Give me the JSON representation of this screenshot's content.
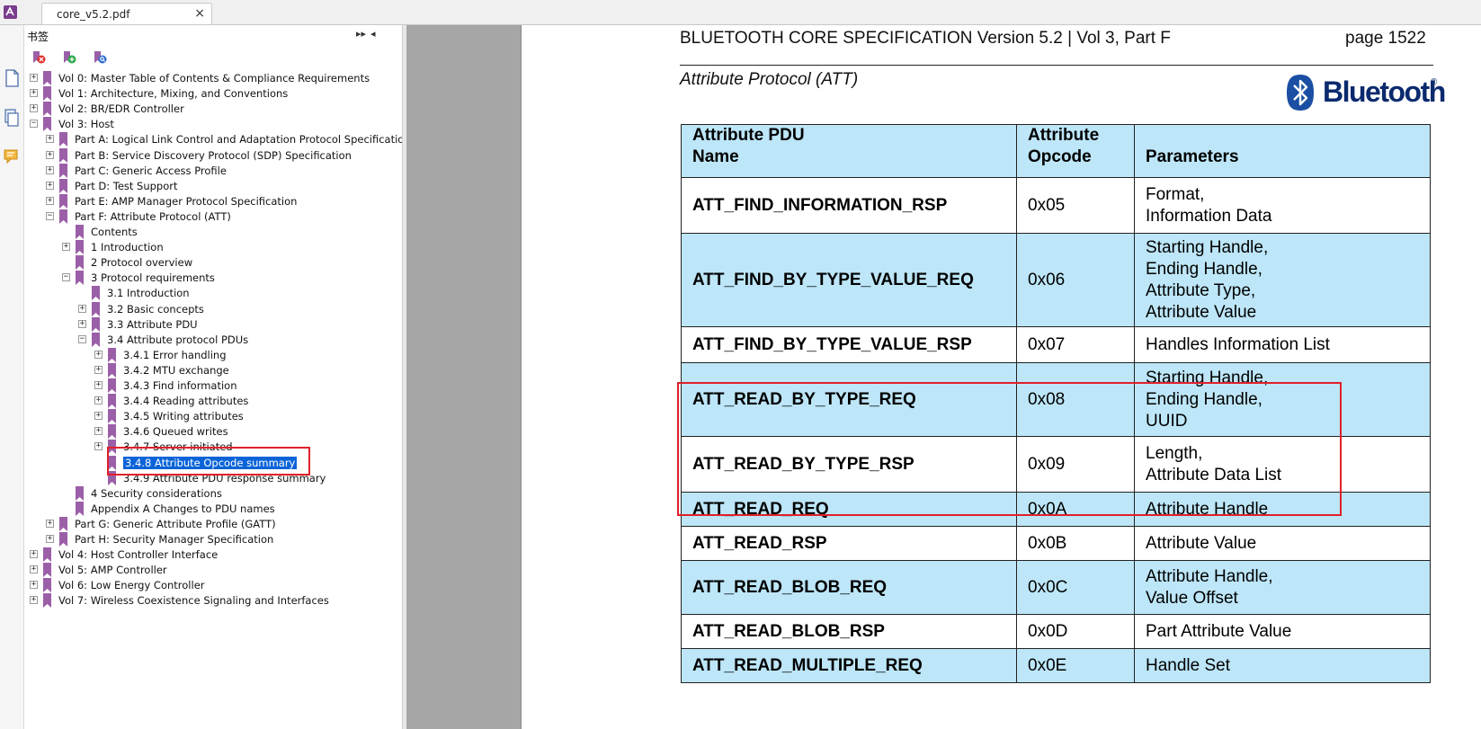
{
  "tab": {
    "title": "core_v5.2.pdf",
    "close_glyph": "×"
  },
  "bookmarks_panel": {
    "title": "书签",
    "controls": {
      "expand": "▸▸",
      "collapse": "◂"
    },
    "items": [
      {
        "label": "Vol 0: Master Table of Contents & Compliance Requirements",
        "level": 0,
        "expander": "+"
      },
      {
        "label": "Vol 1: Architecture, Mixing, and Conventions",
        "level": 0,
        "expander": "+"
      },
      {
        "label": "Vol 2: BR/EDR Controller",
        "level": 0,
        "expander": "+"
      },
      {
        "label": "Vol 3: Host",
        "level": 0,
        "expander": "−"
      },
      {
        "label": "Part A: Logical Link Control and Adaptation Protocol Specification",
        "level": 1,
        "expander": "+"
      },
      {
        "label": "Part B: Service Discovery Protocol (SDP) Specification",
        "level": 1,
        "expander": "+"
      },
      {
        "label": "Part C: Generic Access Profile",
        "level": 1,
        "expander": "+"
      },
      {
        "label": "Part D: Test Support",
        "level": 1,
        "expander": "+"
      },
      {
        "label": "Part E: AMP Manager Protocol Specification",
        "level": 1,
        "expander": "+"
      },
      {
        "label": "Part F: Attribute Protocol (ATT)",
        "level": 1,
        "expander": "−"
      },
      {
        "label": "Contents",
        "level": 2,
        "expander": ""
      },
      {
        "label": "1 Introduction",
        "level": 2,
        "expander": "+"
      },
      {
        "label": "2 Protocol overview",
        "level": 2,
        "expander": ""
      },
      {
        "label": "3 Protocol requirements",
        "level": 2,
        "expander": "−"
      },
      {
        "label": "3.1 Introduction",
        "level": 3,
        "expander": ""
      },
      {
        "label": "3.2 Basic concepts",
        "level": 3,
        "expander": "+"
      },
      {
        "label": "3.3 Attribute PDU",
        "level": 3,
        "expander": "+"
      },
      {
        "label": "3.4 Attribute protocol PDUs",
        "level": 3,
        "expander": "−"
      },
      {
        "label": "3.4.1 Error handling",
        "level": 4,
        "expander": "+"
      },
      {
        "label": "3.4.2 MTU exchange",
        "level": 4,
        "expander": "+"
      },
      {
        "label": "3.4.3 Find information",
        "level": 4,
        "expander": "+"
      },
      {
        "label": "3.4.4 Reading attributes",
        "level": 4,
        "expander": "+"
      },
      {
        "label": "3.4.5 Writing attributes",
        "level": 4,
        "expander": "+"
      },
      {
        "label": "3.4.6 Queued writes",
        "level": 4,
        "expander": "+"
      },
      {
        "label": "3.4.7 Server initiated",
        "level": 4,
        "expander": "+"
      },
      {
        "label": "3.4.8 Attribute Opcode summary",
        "level": 4,
        "expander": "",
        "selected": true
      },
      {
        "label": "3.4.9 Attribute PDU response summary",
        "level": 4,
        "expander": ""
      },
      {
        "label": "4 Security considerations",
        "level": 2,
        "expander": ""
      },
      {
        "label": "Appendix A Changes to PDU names",
        "level": 2,
        "expander": ""
      },
      {
        "label": "Part G: Generic Attribute Profile (GATT)",
        "level": 1,
        "expander": "+"
      },
      {
        "label": "Part H: Security Manager Specification",
        "level": 1,
        "expander": "+"
      },
      {
        "label": "Vol 4: Host Controller Interface",
        "level": 0,
        "expander": "+"
      },
      {
        "label": "Vol 5: AMP Controller",
        "level": 0,
        "expander": "+"
      },
      {
        "label": "Vol 6: Low Energy Controller",
        "level": 0,
        "expander": "+"
      },
      {
        "label": "Vol 7: Wireless Coexistence Signaling and Interfaces",
        "level": 0,
        "expander": "+"
      }
    ]
  },
  "document": {
    "header_title": "BLUETOOTH CORE SPECIFICATION Version 5.2 | Vol 3, Part F",
    "page_label": "page 1522",
    "section_title": "Attribute Protocol (ATT)",
    "logo_text": "Bluetooth",
    "logo_mark": "®",
    "table": {
      "headers": [
        {
          "line1": "Attribute PDU",
          "line2": "Name"
        },
        {
          "line1": "Attribute",
          "line2": "Opcode"
        },
        {
          "line1": "",
          "line2": "Parameters"
        }
      ],
      "rows": [
        {
          "name": "ATT_FIND_INFORMATION_RSP",
          "opcode": "0x05",
          "params": [
            "Format,",
            "Information Data"
          ]
        },
        {
          "name": "ATT_FIND_BY_TYPE_VALUE_REQ",
          "opcode": "0x06",
          "params": [
            "Starting Handle,",
            "Ending Handle,",
            "Attribute Type,",
            "Attribute Value"
          ]
        },
        {
          "name": "ATT_FIND_BY_TYPE_VALUE_RSP",
          "opcode": "0x07",
          "params": [
            "Handles Information List"
          ]
        },
        {
          "name": "ATT_READ_BY_TYPE_REQ",
          "opcode": "0x08",
          "params": [
            "Starting Handle,",
            "Ending Handle,",
            "UUID"
          ]
        },
        {
          "name": "ATT_READ_BY_TYPE_RSP",
          "opcode": "0x09",
          "params": [
            "Length,",
            "Attribute Data List"
          ]
        },
        {
          "name": "ATT_READ_REQ",
          "opcode": "0x0A",
          "params": [
            "Attribute Handle"
          ]
        },
        {
          "name": "ATT_READ_RSP",
          "opcode": "0x0B",
          "params": [
            "Attribute Value"
          ]
        },
        {
          "name": "ATT_READ_BLOB_REQ",
          "opcode": "0x0C",
          "params": [
            "Attribute Handle,",
            "Value Offset"
          ]
        },
        {
          "name": "ATT_READ_BLOB_RSP",
          "opcode": "0x0D",
          "params": [
            "Part Attribute Value"
          ]
        },
        {
          "name": "ATT_READ_MULTIPLE_REQ",
          "opcode": "0x0E",
          "params": [
            "Handle Set"
          ]
        }
      ]
    }
  },
  "colors": {
    "table_blue": "#bde6f8",
    "selection": "#0a64d8",
    "highlight_box": "#e0202a",
    "bookmark_icon": "#9b5fa8",
    "logo_blue": "#1a4fa3"
  }
}
